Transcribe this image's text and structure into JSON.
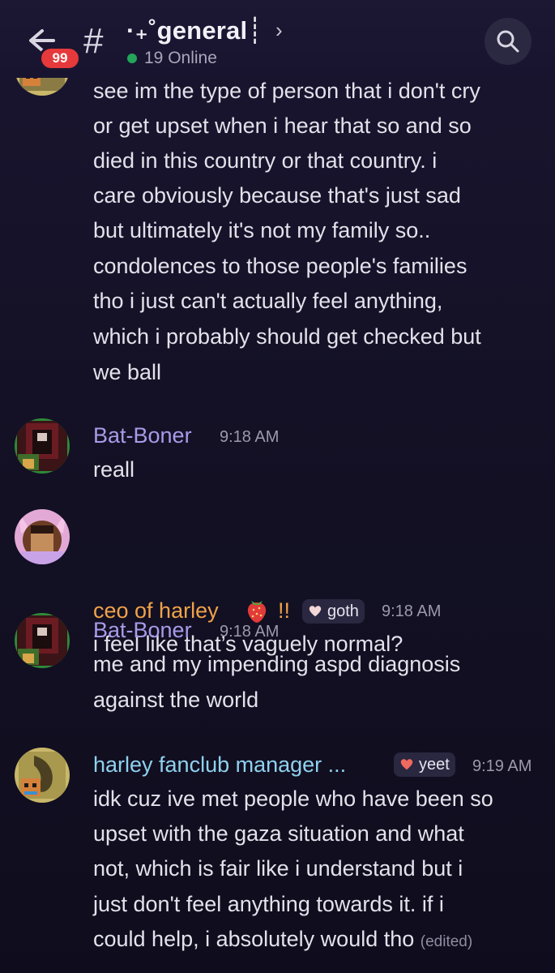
{
  "header": {
    "unread_count": "99",
    "channel_name": "·₊˚general┊",
    "online_status": "19 Online"
  },
  "colors": {
    "background": "#141126",
    "username_purple": "#a79be8",
    "username_orange": "#f0a24a",
    "username_cyan": "#8fd1ee",
    "online_green": "#23a55a",
    "badge_red": "#e5393b"
  },
  "messages": [
    {
      "author": "",
      "time": "",
      "lines": [
        "see im the type of person that i don't cry",
        "or get upset when i hear that so and so",
        "died in this country or that country. i",
        "care obviously because that's just sad",
        "but ultimately it's not my family so..",
        "condolences to those people's families",
        "tho i just can't actually feel anything,",
        "which i probably should get checked but",
        "we ball"
      ]
    },
    {
      "author": "Bat-Boner",
      "time": "9:18 AM",
      "lines": [
        "reall"
      ]
    },
    {
      "author": "ceo of harley",
      "author_suffix": "!!",
      "role_tag": "goth",
      "time": "9:18 AM",
      "lines": [
        "i feel like that’s vaguely normal?"
      ]
    },
    {
      "author": "Bat-Boner",
      "time": "9:18 AM",
      "lines": [
        "me and my impending aspd diagnosis",
        "against the world"
      ]
    },
    {
      "author": "harley fanclub manager ...",
      "role_tag": "yeet",
      "time": "9:19 AM",
      "lines": [
        "idk cuz ive met people who have been so",
        "upset with the gaza situation and what",
        "not, which is fair like i understand but i",
        "just don't feel anything towards it. if i",
        "could help, i absolutely would tho"
      ],
      "edited_label": "(edited)"
    }
  ],
  "icons": {
    "back": "arrow-left-icon",
    "channel": "hash-icon",
    "open_details": "chevron-right-icon",
    "search": "search-icon",
    "strawberry": "strawberry-icon",
    "heart": "heart-icon"
  }
}
